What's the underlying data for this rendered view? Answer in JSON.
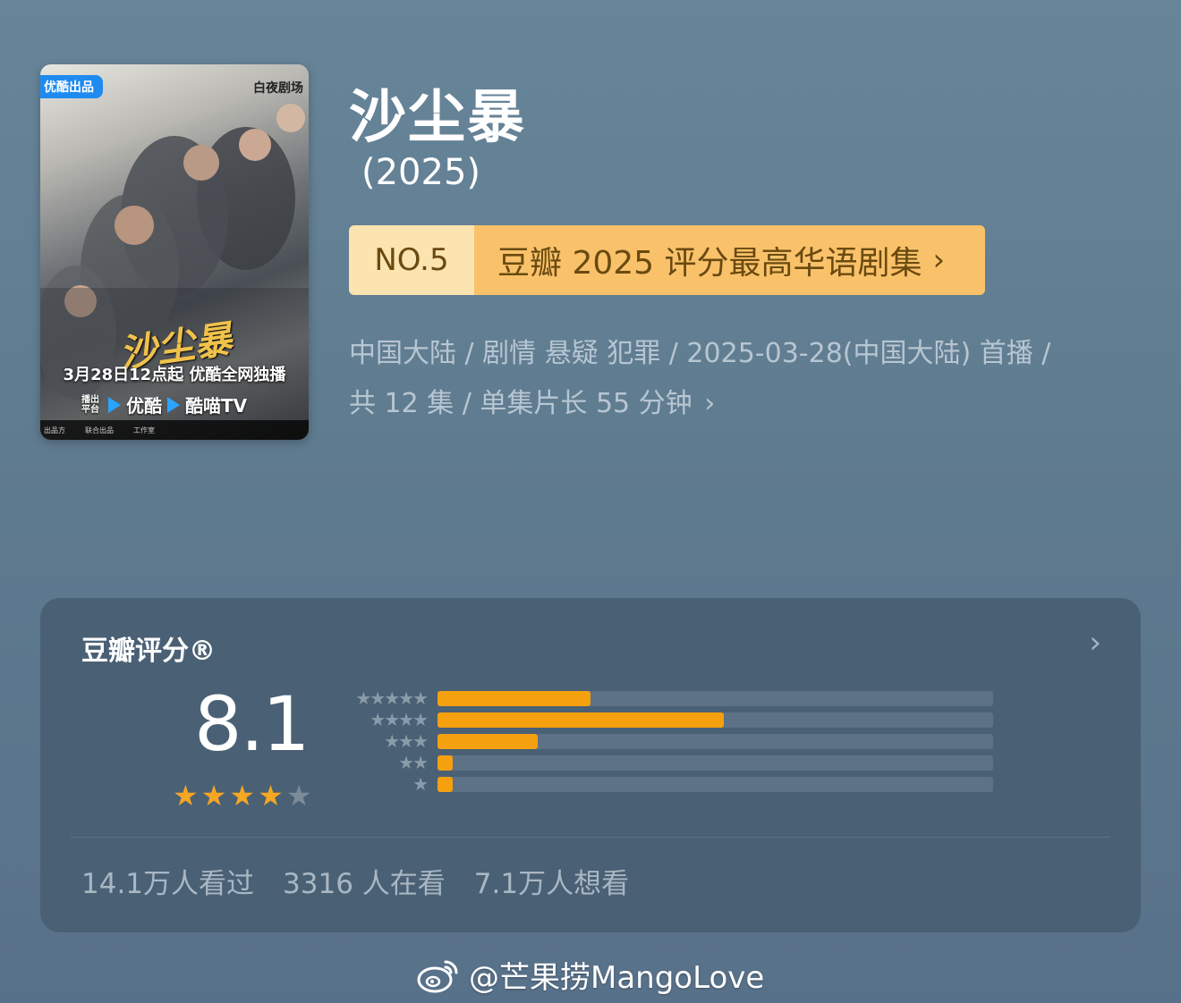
{
  "poster": {
    "brand_badge": "优酷出品",
    "studio": "白夜剧场",
    "title": "沙尘暴",
    "release": "3月28日12点起 优酷全网独播",
    "platform_label": "播出平台",
    "platform_1": "优酷",
    "platform_2": "酷喵TV",
    "credits_1": "出品方",
    "credits_2": "联合出品",
    "credits_3": "工作室"
  },
  "show": {
    "title": "沙尘暴",
    "year": "(2025)"
  },
  "rank": {
    "number": "NO.5",
    "label": "豆瓣 2025 评分最高华语剧集"
  },
  "meta": {
    "line1": "中国大陆 / 剧情 悬疑 犯罪 / 2025-03-28(中国大陆) 首播 /",
    "line2": "共 12 集 / 单集片长 55 分钟"
  },
  "rating": {
    "title": "豆瓣评分®",
    "score": "8.1",
    "stars_filled": 4,
    "stars_total": 5,
    "distribution": [
      {
        "stars": 5,
        "fraction": 0.275
      },
      {
        "stars": 4,
        "fraction": 0.515
      },
      {
        "stars": 3,
        "fraction": 0.18
      },
      {
        "stars": 2,
        "fraction": 0.028
      },
      {
        "stars": 1,
        "fraction": 0.028
      }
    ],
    "stats": {
      "watched": "14.1万人看过",
      "watching": "3316 人在看",
      "want": "7.1万人想看"
    }
  },
  "watermark": {
    "text": "@芒果捞MangoLove",
    "icon": "weibo-icon"
  },
  "colors": {
    "accent": "#f5a00f",
    "rank_light": "#fce4b0",
    "rank_main": "#f9c26a"
  }
}
